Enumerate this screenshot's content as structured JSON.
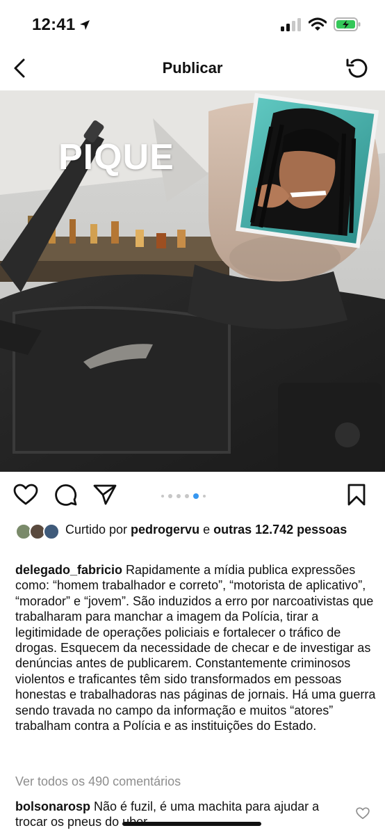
{
  "status_bar": {
    "time": "12:41",
    "location_icon": "location-arrow-icon",
    "signal_icon": "cellular-signal-icon",
    "wifi_icon": "wifi-icon",
    "battery_icon": "battery-charging-icon",
    "battery_color": "#34c759"
  },
  "nav": {
    "title": "Publicar",
    "back_icon": "chevron-left-icon",
    "refresh_icon": "refresh-icon"
  },
  "media": {
    "overlay_text": "PIQUE",
    "carousel_total": 6,
    "carousel_active_index": 4
  },
  "actions": {
    "like_icon": "heart-icon",
    "comment_icon": "comment-icon",
    "share_icon": "send-icon",
    "save_icon": "bookmark-icon",
    "accent_color": "#3797f0"
  },
  "likes": {
    "prefix": "Curtido por ",
    "user": "pedrogervu",
    "middle": " e ",
    "others": "outras 12.742 pessoas"
  },
  "caption": {
    "username": "delegado_fabricio",
    "text": " Rapidamente a mídia publica expressões como: “homem trabalhador e correto”, “motorista de aplicativo”, “morador” e “jovem”. São induzidos a erro por narcoativistas que trabalharam para manchar a imagem da Polícia, tirar a legitimidade de operações policiais e fortalecer o tráfico de drogas. Esquecem da necessidade de checar e de investigar as denúncias antes de publicarem. Constantemente criminosos violentos e traficantes têm sido transformados em pessoas honestas e trabalhadoras nas páginas de jornais. Há uma guerra sendo travada no campo da informação e muitos “atores” trabalham contra a Polícia e as instituições do Estado."
  },
  "comments": {
    "view_all": "Ver todos os 490 comentários",
    "first": {
      "username": "bolsonarosp",
      "text": " Não é fuzil, é uma machita para ajudar a trocar os pneus do uber"
    }
  }
}
